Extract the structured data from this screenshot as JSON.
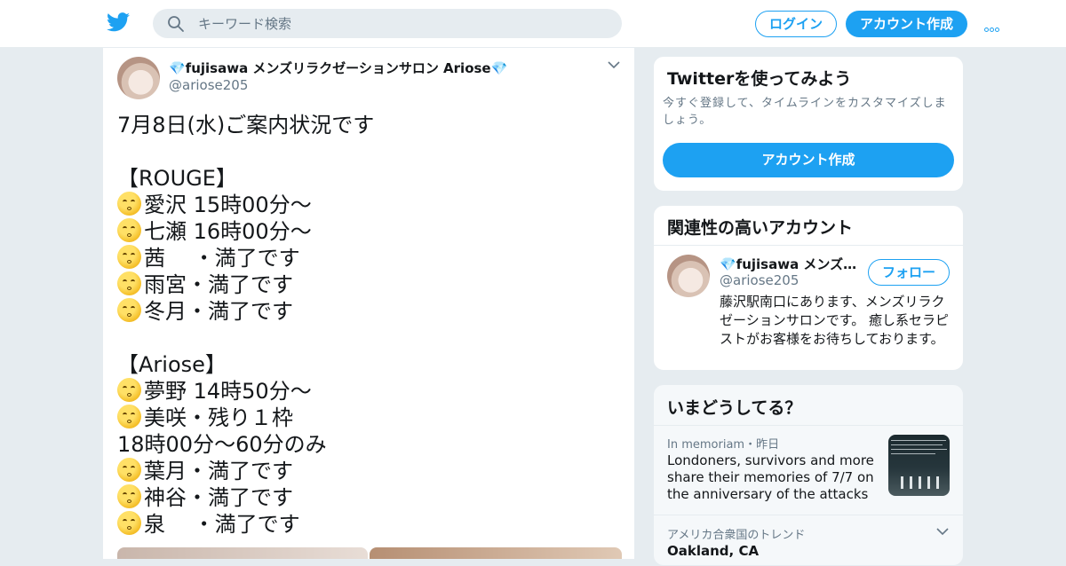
{
  "header": {
    "search_placeholder": "キーワード検索",
    "login_label": "ログイン",
    "signup_label": "アカウント作成",
    "brand_color": "#1da1f2"
  },
  "tweet": {
    "display_name": "💎fujisawa メンズリラクゼーションサロン Ariose💎",
    "handle": "@ariose205",
    "lines": [
      {
        "emoji": false,
        "text": "7月8日(水)ご案内状況です"
      },
      {
        "emoji": false,
        "text": ""
      },
      {
        "emoji": false,
        "text": "【ROUGE】"
      },
      {
        "emoji": true,
        "text": "愛沢 15時00分～"
      },
      {
        "emoji": true,
        "text": "七瀬 16時00分～"
      },
      {
        "emoji": true,
        "text": "茜　 ・満了です"
      },
      {
        "emoji": true,
        "text": "雨宮・満了です"
      },
      {
        "emoji": true,
        "text": "冬月・満了です"
      },
      {
        "emoji": false,
        "text": ""
      },
      {
        "emoji": false,
        "text": "【Ariose】"
      },
      {
        "emoji": true,
        "text": "夢野 14時50分～"
      },
      {
        "emoji": true,
        "text": "美咲・残り１枠"
      },
      {
        "emoji": false,
        "text": "18時00分～60分のみ"
      },
      {
        "emoji": true,
        "text": "葉月・満了です"
      },
      {
        "emoji": true,
        "text": "神谷・満了です"
      },
      {
        "emoji": true,
        "text": "泉　 ・満了です"
      }
    ]
  },
  "signup_card": {
    "title": "Twitterを使ってみよう",
    "description": "今すぐ登録して、タイムラインをカスタマイズしましょう。",
    "button_label": "アカウント作成"
  },
  "related_card": {
    "title": "関連性の高いアカウント",
    "account_name": "💎fujisawa メンズリラクゼーションサロン Ariose💎",
    "account_handle": "@ariose205",
    "follow_label": "フォロー",
    "bio": "藤沢駅南口にあります、メンズリラクゼーションサロンです。 癒し系セラピストがお客様をお待ちしております。"
  },
  "trends_card": {
    "title": "いまどうしてる？",
    "story_meta": "In memoriam・昨日",
    "story_title": "Londoners, survivors and more share their memories of 7/7 on the anniversary of the attacks",
    "trend_meta": "アメリカ合衆国のトレンド",
    "trend_location": "Oakland, CA"
  }
}
